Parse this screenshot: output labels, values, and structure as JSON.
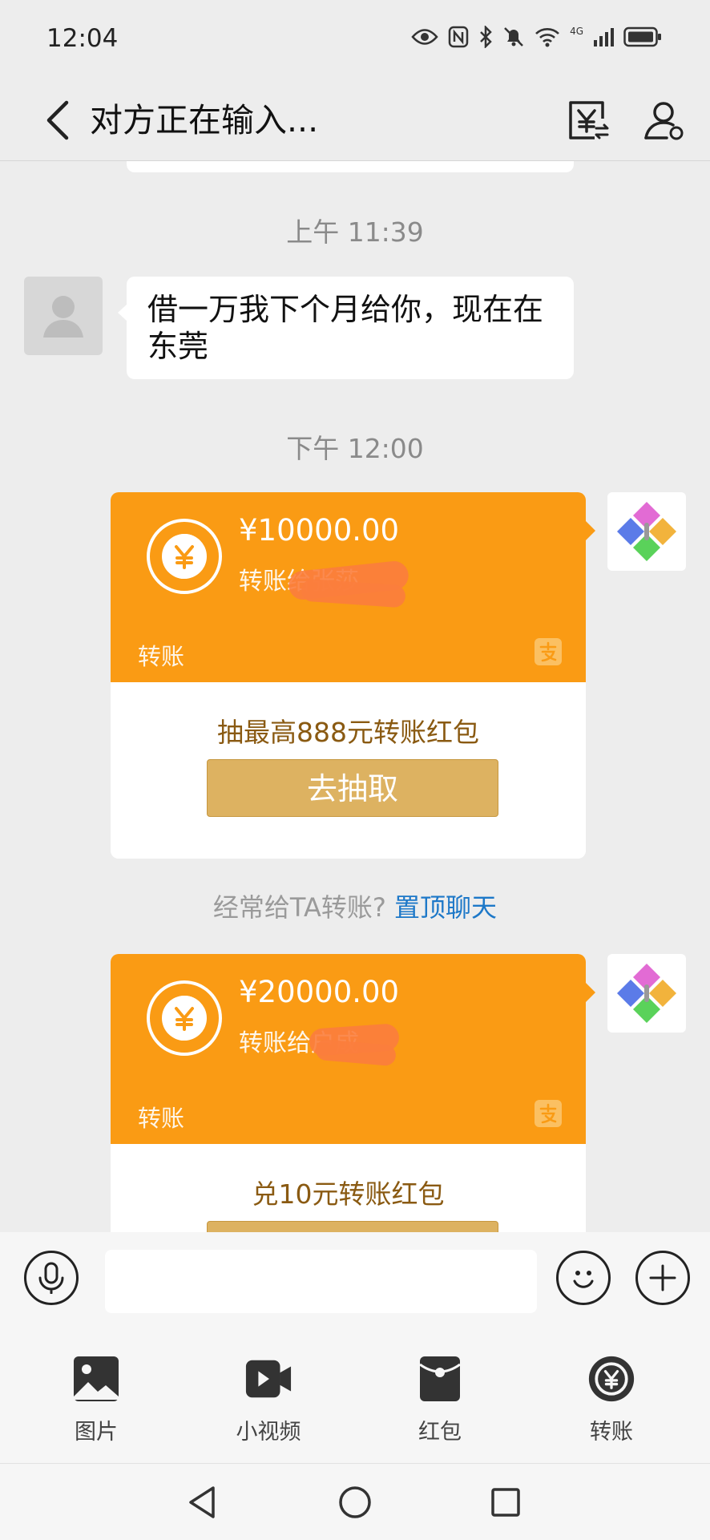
{
  "status_bar": {
    "time": "12:04",
    "network": "4G"
  },
  "header": {
    "title": "对方正在输入..."
  },
  "chat": {
    "time_1": "上午 11:39",
    "incoming_message": "借一万我下个月给你，现在在东莞",
    "time_2": "下午 12:00",
    "transfers": [
      {
        "amount": "¥10000.00",
        "recipient": "转账给张莎",
        "label": "转账",
        "promo": "抽最高888元转账红包",
        "button": "去抽取"
      },
      {
        "amount": "¥20000.00",
        "recipient": "转账给户成",
        "label": "转账",
        "promo": "兑10元转账红包"
      }
    ],
    "tip_text": "经常给TA转账?",
    "tip_link": "置顶聊天"
  },
  "input": {
    "placeholder": ""
  },
  "panel": {
    "items": [
      {
        "label": "图片",
        "icon": "image-icon"
      },
      {
        "label": "小视频",
        "icon": "video-icon"
      },
      {
        "label": "红包",
        "icon": "red-packet-icon"
      },
      {
        "label": "转账",
        "icon": "transfer-icon"
      }
    ]
  },
  "colors": {
    "orange": "#fa9b14",
    "gold_button": "#ddb261",
    "link_blue": "#1d78c8",
    "background": "#ededed"
  }
}
